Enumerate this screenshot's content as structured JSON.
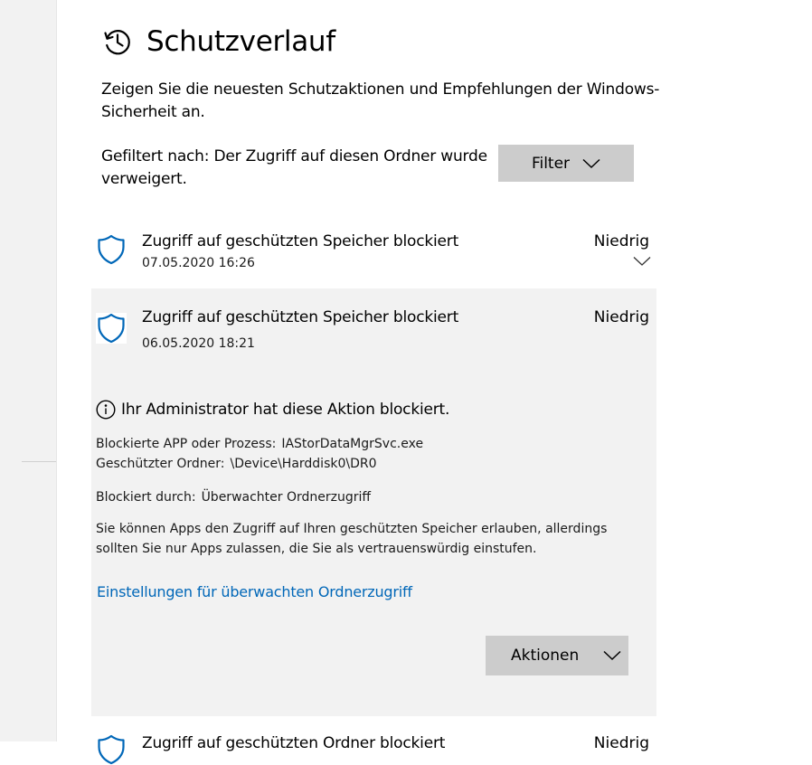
{
  "page": {
    "title": "Schutzverlauf",
    "description": "Zeigen Sie die neuesten Schutzaktionen und Empfehlungen der Windows-Sicherheit an.",
    "filter_text": "Gefiltert nach: Der Zugriff auf diesen Ordner wurde verweigert.",
    "filter_button_label": "Filter"
  },
  "items": [
    {
      "title": "Zugriff auf geschützten Speicher blockiert",
      "date": "07.05.2020 16:26",
      "severity": "Niedrig"
    },
    {
      "title": "Zugriff auf geschützten Speicher blockiert",
      "date": "06.05.2020 18:21",
      "severity": "Niedrig",
      "admin_notice": "Ihr Administrator hat diese Aktion blockiert.",
      "details": [
        {
          "label": "Blockierte APP oder Prozess:",
          "value": "IAStorDataMgrSvc.exe"
        },
        {
          "label": "Geschützter Ordner:",
          "value": "\\Device\\Harddisk0\\DR0"
        },
        {
          "label": "Blockiert durch:",
          "value": "Überwachter Ordnerzugriff"
        }
      ],
      "explanation": "Sie können Apps den Zugriff auf Ihren geschützten Speicher erlauben, allerdings sollten Sie nur Apps zulassen, die Sie als vertrauenswürdig einstufen.",
      "settings_link": "Einstellungen für überwachten Ordnerzugriff",
      "actions_button_label": "Aktionen"
    },
    {
      "title": "Zugriff auf geschützten Ordner blockiert",
      "severity": "Niedrig"
    }
  ],
  "icons": {
    "history": "history-clock-icon",
    "shield": "shield-icon",
    "info": "info-icon",
    "chevron": "chevron-down-icon"
  },
  "colors": {
    "accent": "#0067b8",
    "button_bg": "#cccccc",
    "expanded_bg": "#f2f2f2",
    "sidebar_bg": "#f2f2f2"
  }
}
